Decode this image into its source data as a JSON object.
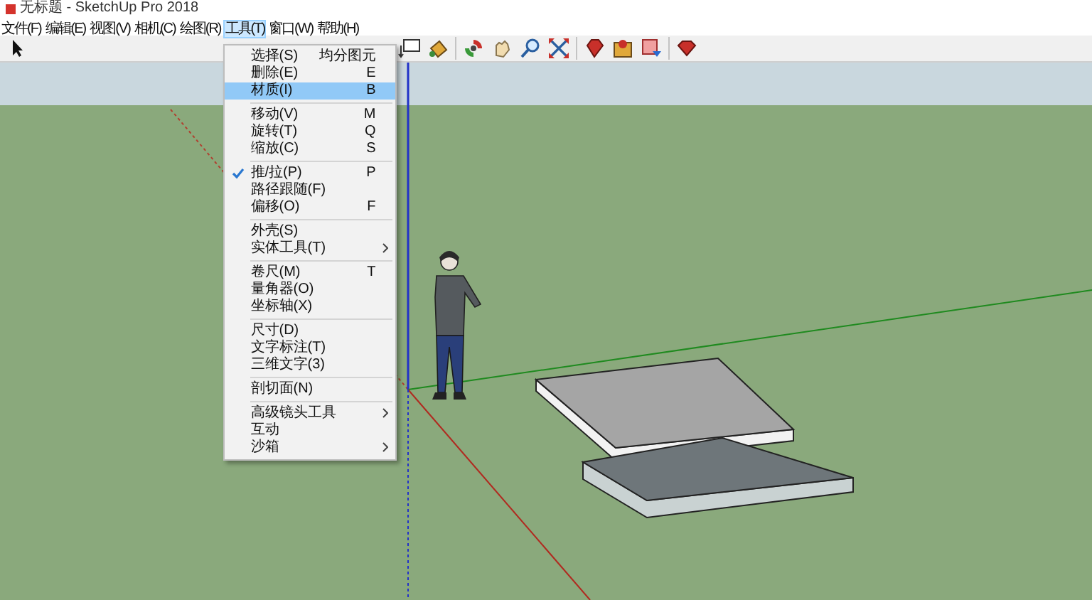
{
  "window": {
    "title": "无标题 - SketchUp Pro 2018"
  },
  "menubar": [
    {
      "label": "文件(F)",
      "selected": false
    },
    {
      "label": "编辑(E)",
      "selected": false
    },
    {
      "label": "视图(V)",
      "selected": false
    },
    {
      "label": "相机(C)",
      "selected": false
    },
    {
      "label": "绘图(R)",
      "selected": false
    },
    {
      "label": "工具(T)",
      "selected": true
    },
    {
      "label": "窗口(W)",
      "selected": false
    },
    {
      "label": "帮助(H)",
      "selected": false
    }
  ],
  "tools_menu": {
    "groups": [
      [
        {
          "label": "选择(S)",
          "shortcut": "均分图元",
          "checked": false,
          "selected": false,
          "submenu": false
        },
        {
          "label": "删除(E)",
          "shortcut": "E",
          "checked": false,
          "selected": false,
          "submenu": false
        },
        {
          "label": "材质(I)",
          "shortcut": "B",
          "checked": false,
          "selected": true,
          "submenu": false
        }
      ],
      [
        {
          "label": "移动(V)",
          "shortcut": "M",
          "checked": false,
          "selected": false,
          "submenu": false
        },
        {
          "label": "旋转(T)",
          "shortcut": "Q",
          "checked": false,
          "selected": false,
          "submenu": false
        },
        {
          "label": "缩放(C)",
          "shortcut": "S",
          "checked": false,
          "selected": false,
          "submenu": false
        }
      ],
      [
        {
          "label": "推/拉(P)",
          "shortcut": "P",
          "checked": true,
          "selected": false,
          "submenu": false
        },
        {
          "label": "路径跟随(F)",
          "checked": false,
          "selected": false,
          "submenu": false
        },
        {
          "label": "偏移(O)",
          "shortcut": "F",
          "checked": false,
          "selected": false,
          "submenu": false
        }
      ],
      [
        {
          "label": "外壳(S)",
          "checked": false,
          "selected": false,
          "submenu": false
        },
        {
          "label": "实体工具(T)",
          "checked": false,
          "selected": false,
          "submenu": true
        }
      ],
      [
        {
          "label": "卷尺(M)",
          "shortcut": "T",
          "checked": false,
          "selected": false,
          "submenu": false
        },
        {
          "label": "量角器(O)",
          "checked": false,
          "selected": false,
          "submenu": false
        },
        {
          "label": "坐标轴(X)",
          "checked": false,
          "selected": false,
          "submenu": false
        }
      ],
      [
        {
          "label": "尺寸(D)",
          "checked": false,
          "selected": false,
          "submenu": false
        },
        {
          "label": "文字标注(T)",
          "checked": false,
          "selected": false,
          "submenu": false
        },
        {
          "label": "三维文字(3)",
          "checked": false,
          "selected": false,
          "submenu": false
        }
      ],
      [
        {
          "label": "剖切面(N)",
          "checked": false,
          "selected": false,
          "submenu": false
        }
      ],
      [
        {
          "label": "高级镜头工具",
          "checked": false,
          "selected": false,
          "submenu": true
        },
        {
          "label": "互动",
          "checked": false,
          "selected": false,
          "submenu": false
        },
        {
          "label": "沙箱",
          "checked": false,
          "selected": false,
          "submenu": true
        }
      ]
    ]
  }
}
